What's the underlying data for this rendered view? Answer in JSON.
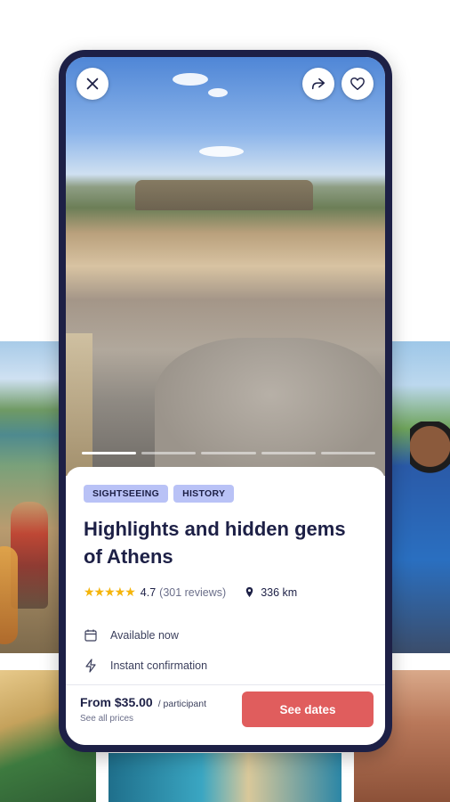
{
  "hero": {
    "progress_total": 5,
    "progress_active_index": 0
  },
  "actions": {
    "close_icon": "close-icon",
    "share_icon": "share-icon",
    "favorite_icon": "heart-icon"
  },
  "tags": [
    "SIGHTSEEING",
    "HISTORY"
  ],
  "title": "Highlights and hidden gems of Athens",
  "rating": {
    "stars": "★★★★★",
    "score": "4.7",
    "reviews": "(301 reviews)"
  },
  "distance": "336 km",
  "info": {
    "availability": "Available now",
    "confirmation": "Instant confirmation"
  },
  "pricing": {
    "price": "From $35.00",
    "unit": "/ participant",
    "see_all": "See all prices",
    "cta": "See dates"
  },
  "colors": {
    "brand_navy": "#1d2046",
    "tag_bg": "#b9c2f6",
    "cta_red": "#e05d5d",
    "star_yellow": "#f5b50b"
  }
}
